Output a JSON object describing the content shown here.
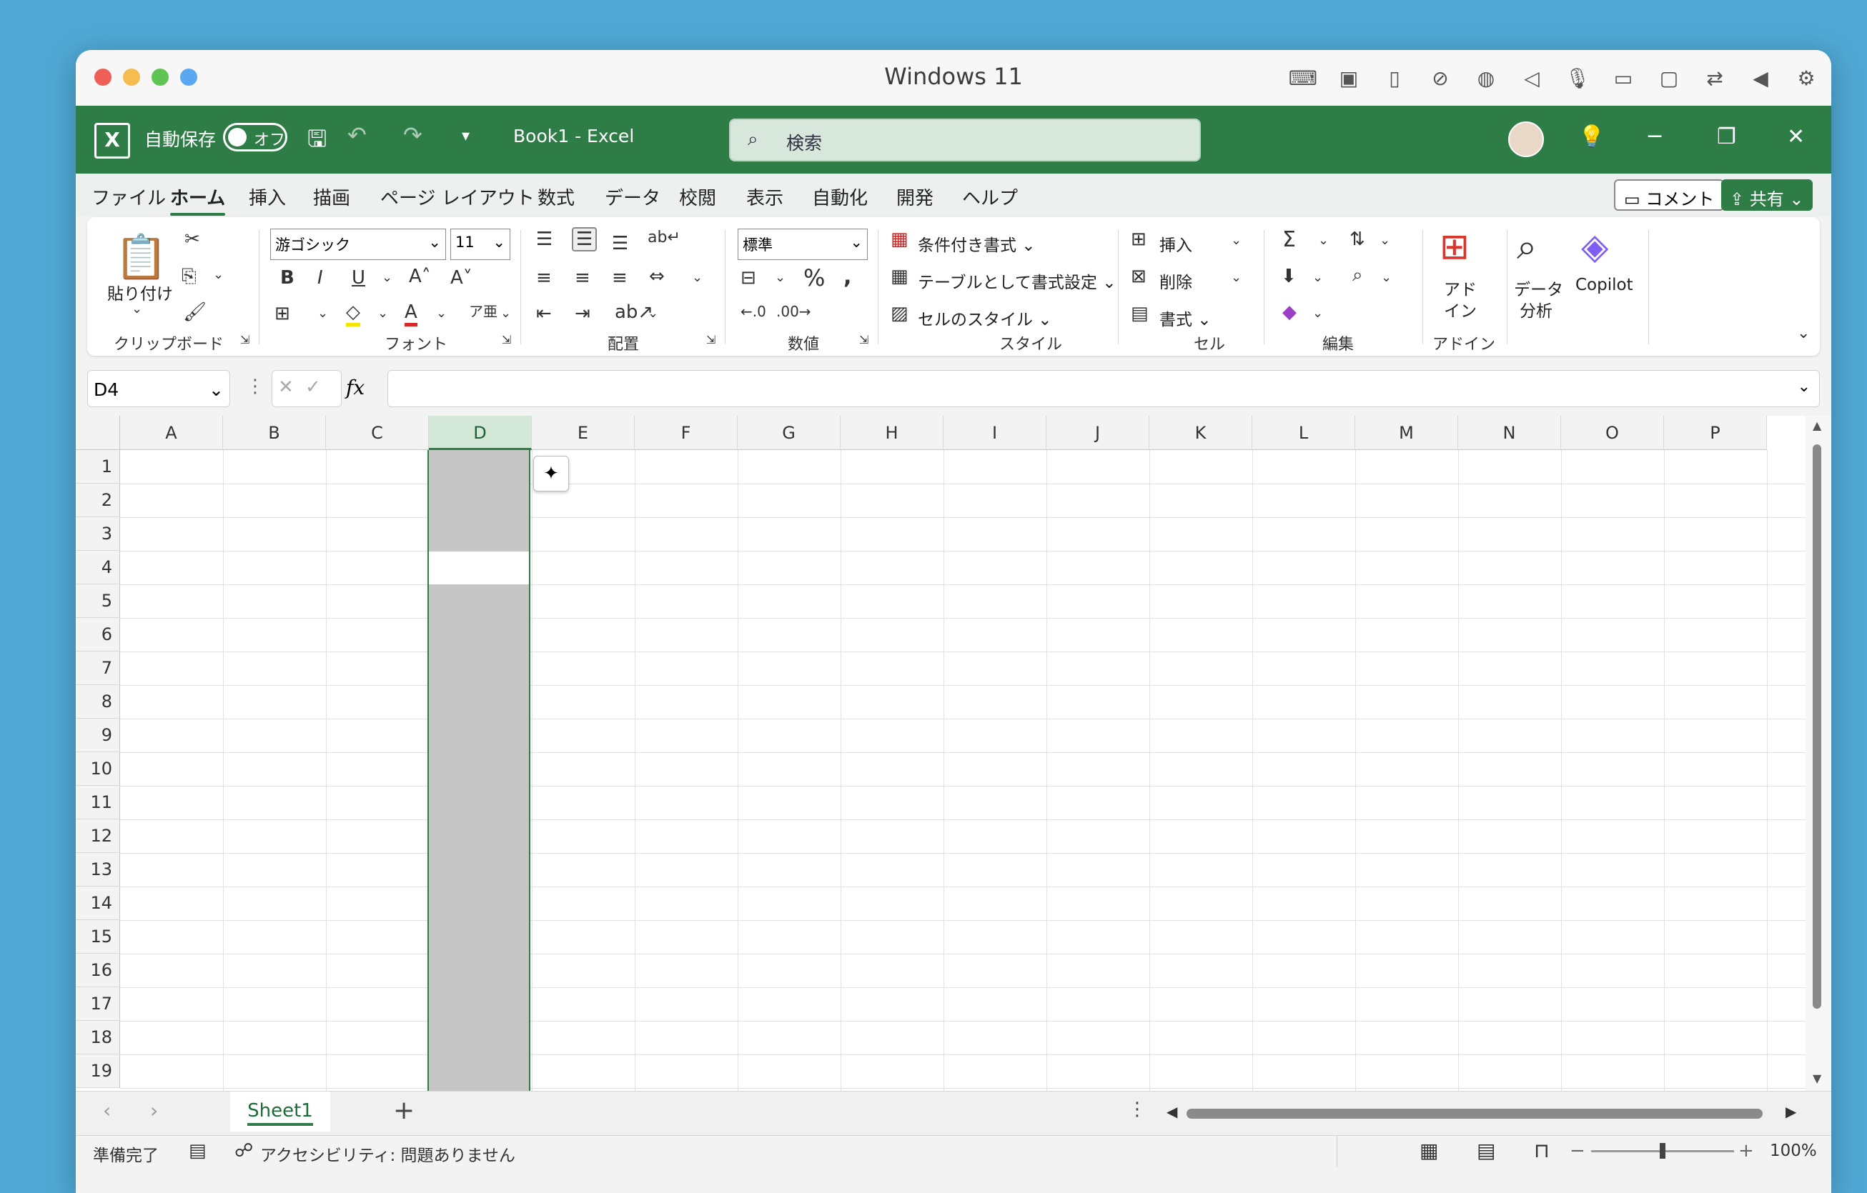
{
  "mac": {
    "title": "Windows 11",
    "colors": {
      "close": "#ee5f57",
      "minimize": "#f5bd4f",
      "zoom": "#5fc454",
      "extra": "#5aa8f0"
    },
    "icons": [
      "keyboard-icon",
      "chip-icon",
      "usb-icon",
      "no-camera-icon",
      "globe-icon",
      "speaker-icon",
      "microphone-icon",
      "drive-icon",
      "video-icon",
      "folder-share-icon",
      "arrow-left-icon",
      "gear-icon"
    ]
  },
  "excel": {
    "autosave_label": "自動保存",
    "autosave_state": "オフ",
    "doc_title": "Book1 - Excel",
    "search_placeholder": "検索",
    "accent": "#2f7d46"
  },
  "menu": {
    "tabs": [
      "ファイル",
      "ホーム",
      "挿入",
      "描画",
      "ページ レイアウト",
      "数式",
      "データ",
      "校閲",
      "表示",
      "自動化",
      "開発",
      "ヘルプ"
    ],
    "active": "ホーム",
    "comment_label": "コメント",
    "share_label": "共有"
  },
  "ribbon": {
    "clipboard": {
      "paste": "貼り付け",
      "group": "クリップボード"
    },
    "font": {
      "name": "游ゴシック",
      "size": "11",
      "group": "フォント"
    },
    "alignment": {
      "group": "配置"
    },
    "number": {
      "format": "標準",
      "group": "数値"
    },
    "styles": {
      "conditional": "条件付き書式",
      "table": "テーブルとして書式設定",
      "cell": "セルのスタイル",
      "group": "スタイル"
    },
    "cells": {
      "insert": "挿入",
      "delete": "削除",
      "format": "書式",
      "group": "セル"
    },
    "editing": {
      "group": "編集"
    },
    "addins": {
      "addin_l1": "アド",
      "addin_l2": "イン",
      "group": "アドイン",
      "analyze_l1": "データ",
      "analyze_l2": "分析",
      "copilot": "Copilot"
    }
  },
  "formula": {
    "name_box": "D4",
    "value": ""
  },
  "grid": {
    "columns": [
      "A",
      "B",
      "C",
      "D",
      "E",
      "F",
      "G",
      "H",
      "I",
      "J",
      "K",
      "L",
      "M",
      "N",
      "O",
      "P"
    ],
    "rows": [
      "1",
      "2",
      "3",
      "4",
      "5",
      "6",
      "7",
      "8",
      "9",
      "10",
      "11",
      "12",
      "13",
      "14",
      "15",
      "16",
      "17",
      "18",
      "19"
    ],
    "selected_column": "D",
    "active_cell": "D4"
  },
  "sheets": {
    "tabs": [
      "Sheet1"
    ],
    "add": "+"
  },
  "status": {
    "ready": "準備完了",
    "accessibility": "アクセシビリティ: 問題ありません",
    "zoom": "100%"
  }
}
